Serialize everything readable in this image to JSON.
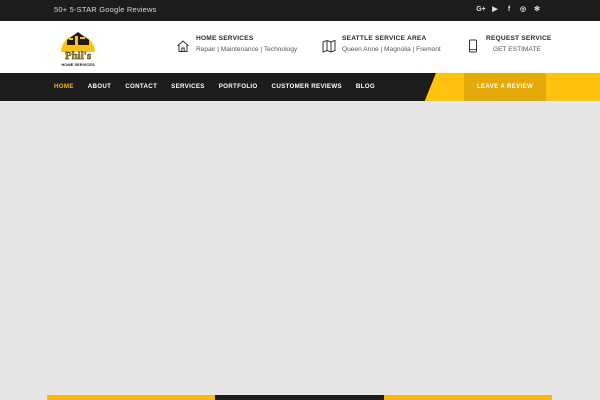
{
  "topbar": {
    "review_text": "50+ 5-STAR Google Reviews",
    "social": [
      {
        "icon": "google-plus-icon",
        "glyph": "G+"
      },
      {
        "icon": "youtube-icon",
        "glyph": "▶"
      },
      {
        "icon": "facebook-icon",
        "glyph": "f"
      },
      {
        "icon": "instagram-icon",
        "glyph": "◎"
      },
      {
        "icon": "yelp-icon",
        "glyph": "✻"
      }
    ]
  },
  "logo": {
    "text_line1": "Phil's",
    "text_line2": "HOME SERVICES"
  },
  "header": {
    "home_services": {
      "title": "HOME SERVICES",
      "subtitle": "Repair | Maintenance | Technology"
    },
    "service_area": {
      "title": "SEATTLE SERVICE AREA",
      "subtitle": "Queen Anne | Magnolia | Fremont"
    },
    "request": {
      "title": "REQUEST SERVICE",
      "subtitle": "GET ESTIMATE"
    }
  },
  "nav": {
    "items": [
      "HOME",
      "ABOUT",
      "CONTACT",
      "SERVICES",
      "PORTFOLIO",
      "CUSTOMER REVIEWS",
      "BLOG"
    ],
    "review_button": "LEAVE A REVIEW"
  },
  "colors": {
    "accent": "#ffc20e",
    "dark": "#1c1c1c",
    "hero_bg": "#e6e6e6"
  }
}
